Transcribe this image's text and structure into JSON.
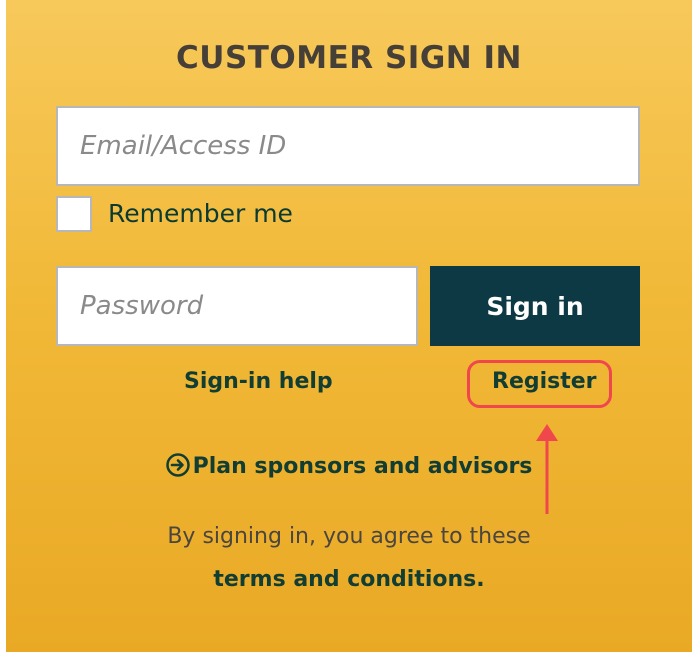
{
  "form": {
    "title": "CUSTOMER SIGN IN",
    "email_placeholder": "Email/Access ID",
    "remember_label": "Remember me",
    "remember_checked": false,
    "password_placeholder": "Password",
    "signin_label": "Sign in",
    "signin_help_label": "Sign-in help",
    "register_label": "Register"
  },
  "links": {
    "sponsors_label": "Plan sponsors and advisors",
    "agree_text": "By signing in, you agree to these",
    "terms_label": "terms and conditions."
  },
  "icons": {
    "sponsors": "arrow-circle-right-icon",
    "annotation": "red-arrow-up-icon"
  },
  "colors": {
    "background_top": "#f7c95b",
    "background_bottom": "#e9a925",
    "button": "#0d3944",
    "link": "#123d33",
    "highlight": "#f0474d"
  }
}
